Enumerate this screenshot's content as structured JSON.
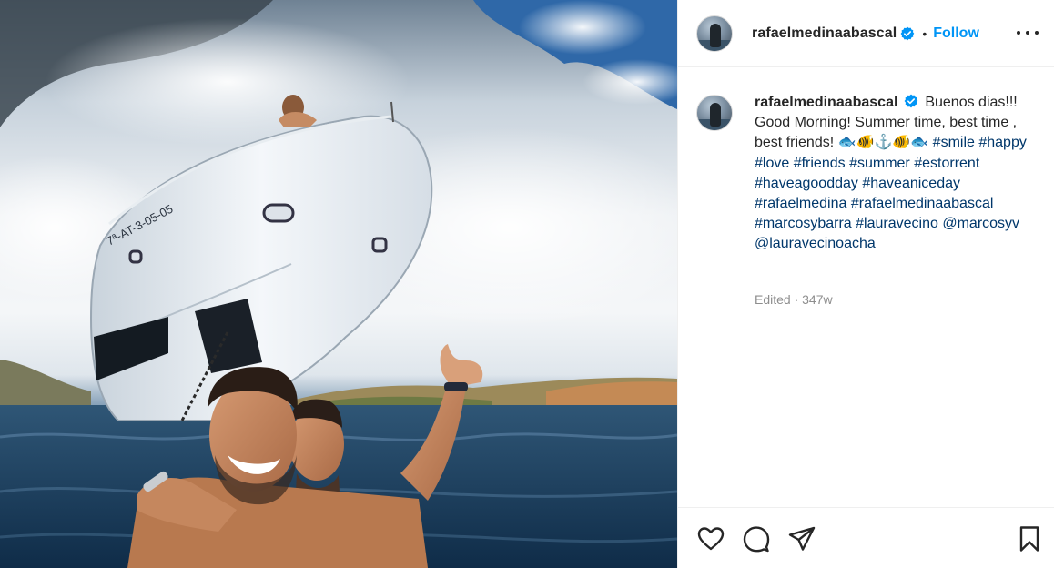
{
  "post": {
    "username": "rafaelmedinaabascal",
    "follow_label": "Follow",
    "separator": "•",
    "boat_registration": "7ª-AT-3-05-05"
  },
  "caption": {
    "username": "rafaelmedinaabascal",
    "text_intro": "Buenos dias!!! Good Morning! Summer time, best time , best friends!",
    "emoji": "🐟🐠⚓🐠🐟",
    "hashtags": [
      "#smile",
      "#happy",
      "#love",
      "#friends",
      "#summer",
      "#estorrent",
      "#haveagoodday",
      "#haveaniceday",
      "#rafaelmedina",
      "#rafaelmedinaabascal",
      "#marcosybarra",
      "#lauravecino"
    ],
    "mentions": [
      "@marcosyv",
      "@lauravecinoacha"
    ]
  },
  "meta": {
    "edited": "Edited · 347w"
  },
  "icons": {
    "verified": "verified-badge-icon",
    "more": "more-options-icon",
    "like": "heart-icon",
    "comment": "comment-bubble-icon",
    "share": "paper-plane-icon",
    "save": "bookmark-icon"
  },
  "colors": {
    "link": "#0095f6",
    "hashtag": "#00376b",
    "muted": "#8e8e8e",
    "text": "#262626",
    "border": "#efefef"
  }
}
